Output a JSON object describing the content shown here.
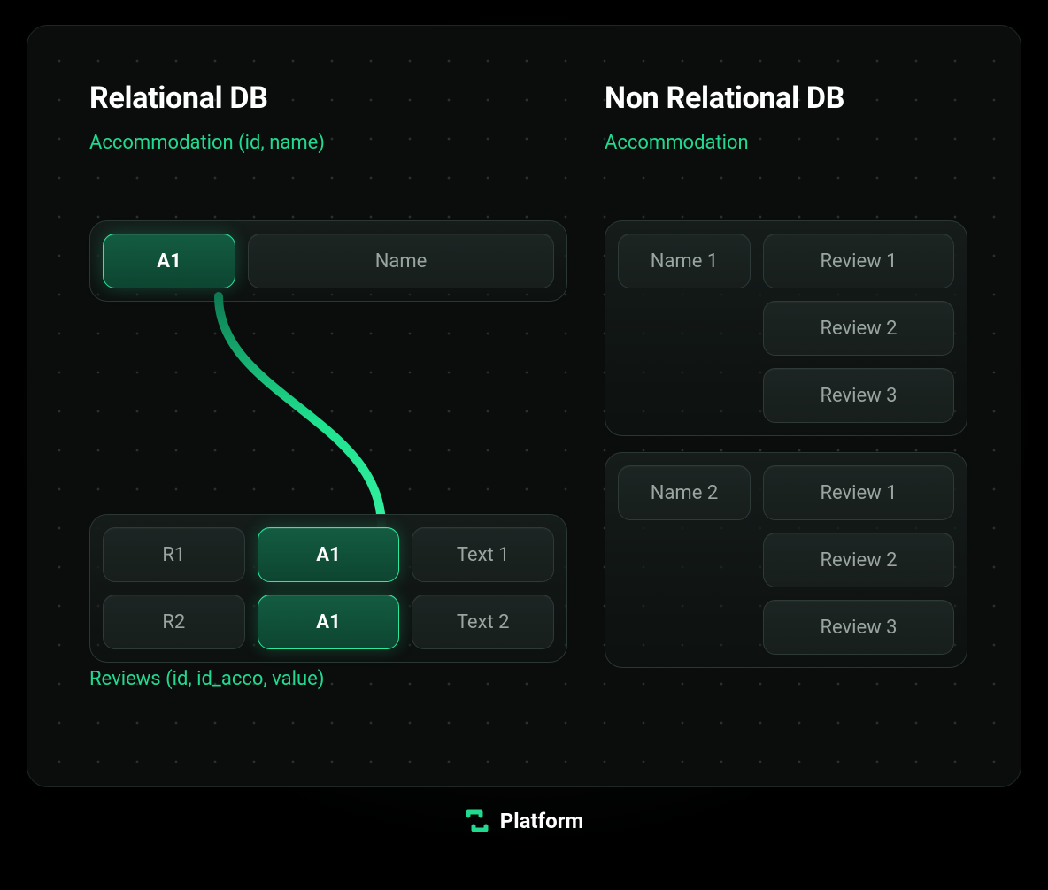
{
  "left": {
    "title": "Relational DB",
    "accommodation_label": "Accommodation (id, name)",
    "accommodation_row": {
      "id": "A1",
      "name": "Name"
    },
    "reviews_label": "Reviews (id, id_acco, value)",
    "reviews_rows": [
      {
        "id": "R1",
        "acco": "A1",
        "value": "Text 1"
      },
      {
        "id": "R2",
        "acco": "A1",
        "value": "Text 2"
      }
    ]
  },
  "right": {
    "title": "Non Relational DB",
    "accommodation_label": "Accommodation",
    "docs": [
      {
        "name": "Name 1",
        "reviews": [
          "Review 1",
          "Review 2",
          "Review 3"
        ]
      },
      {
        "name": "Name 2",
        "reviews": [
          "Review 1",
          "Review 2",
          "Review 3"
        ]
      }
    ]
  },
  "footer": {
    "brand": "Platform"
  }
}
